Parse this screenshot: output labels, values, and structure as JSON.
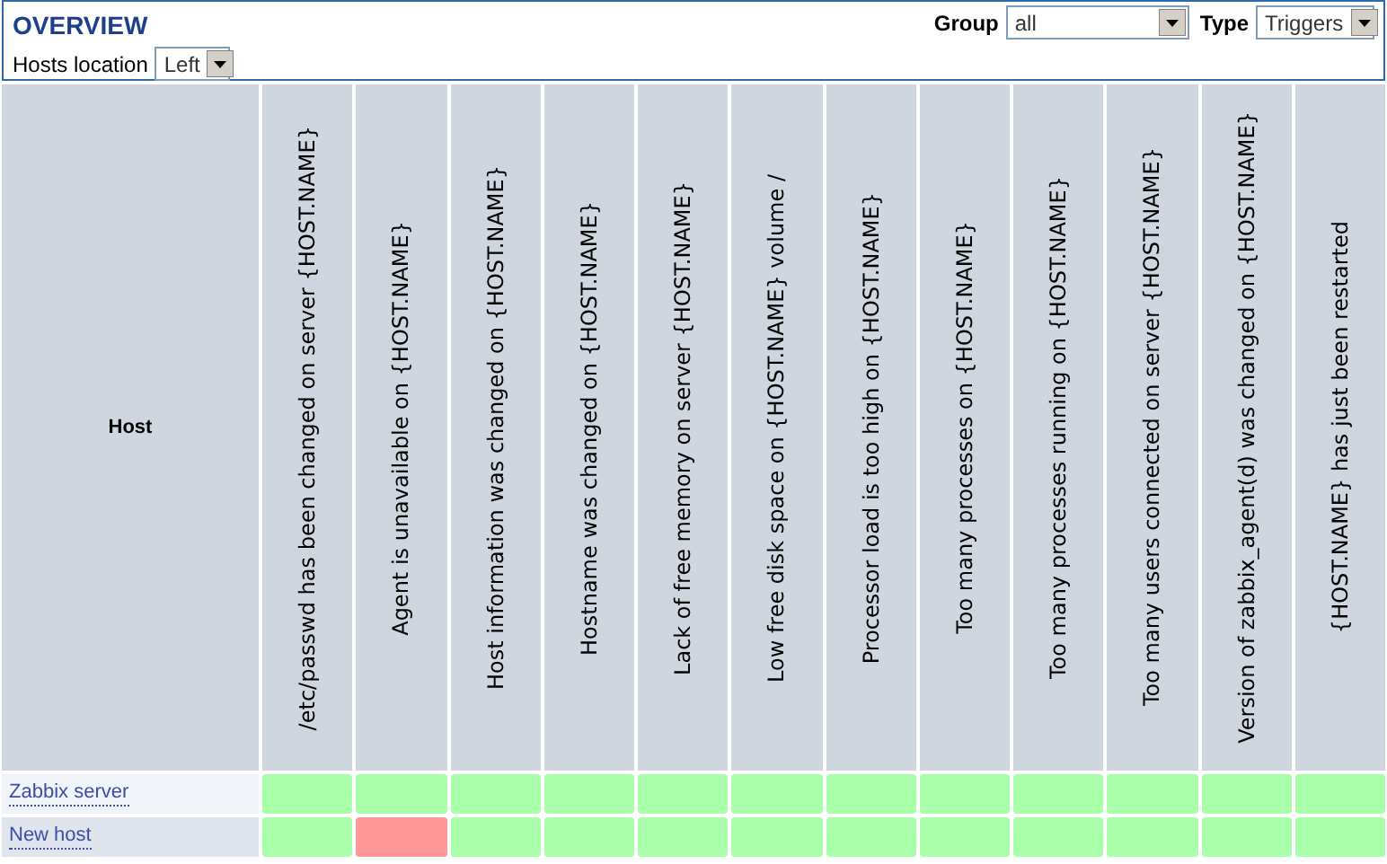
{
  "header": {
    "title": "OVERVIEW",
    "group_label": "Group",
    "group_value": "all",
    "type_label": "Type",
    "type_value": "Triggers",
    "location_label": "Hosts location",
    "location_value": "Left"
  },
  "table": {
    "host_heading": "Host",
    "columns": [
      "/etc/passwd has been changed on server {HOST.NAME}",
      "Agent is unavailable on {HOST.NAME}",
      "Host information was changed on {HOST.NAME}",
      "Hostname was changed on {HOST.NAME}",
      "Lack of free memory on server {HOST.NAME}",
      "Low free disk space on {HOST.NAME} volume /",
      "Processor load is too high on {HOST.NAME}",
      "Too many processes on {HOST.NAME}",
      "Too many processes running on {HOST.NAME}",
      "Too many users connected on server {HOST.NAME}",
      "Version of zabbix_agent(d) was changed on {HOST.NAME}",
      "{HOST.NAME} has just been restarted"
    ],
    "rows": [
      {
        "host": "Zabbix server",
        "cells": [
          {
            "problem": false
          },
          {
            "problem": false
          },
          {
            "problem": false
          },
          {
            "problem": false
          },
          {
            "problem": false
          },
          {
            "problem": false
          },
          {
            "problem": false
          },
          {
            "problem": false
          },
          {
            "problem": false
          },
          {
            "problem": false
          },
          {
            "problem": false
          },
          {
            "problem": false
          }
        ]
      },
      {
        "host": "New host",
        "cells": [
          {
            "problem": false
          },
          {
            "problem": true
          },
          {
            "problem": false
          },
          {
            "problem": false
          },
          {
            "problem": false
          },
          {
            "problem": false
          },
          {
            "problem": false
          },
          {
            "problem": false
          },
          {
            "problem": false
          },
          {
            "problem": false
          },
          {
            "problem": false
          },
          {
            "problem": false
          }
        ]
      }
    ]
  }
}
